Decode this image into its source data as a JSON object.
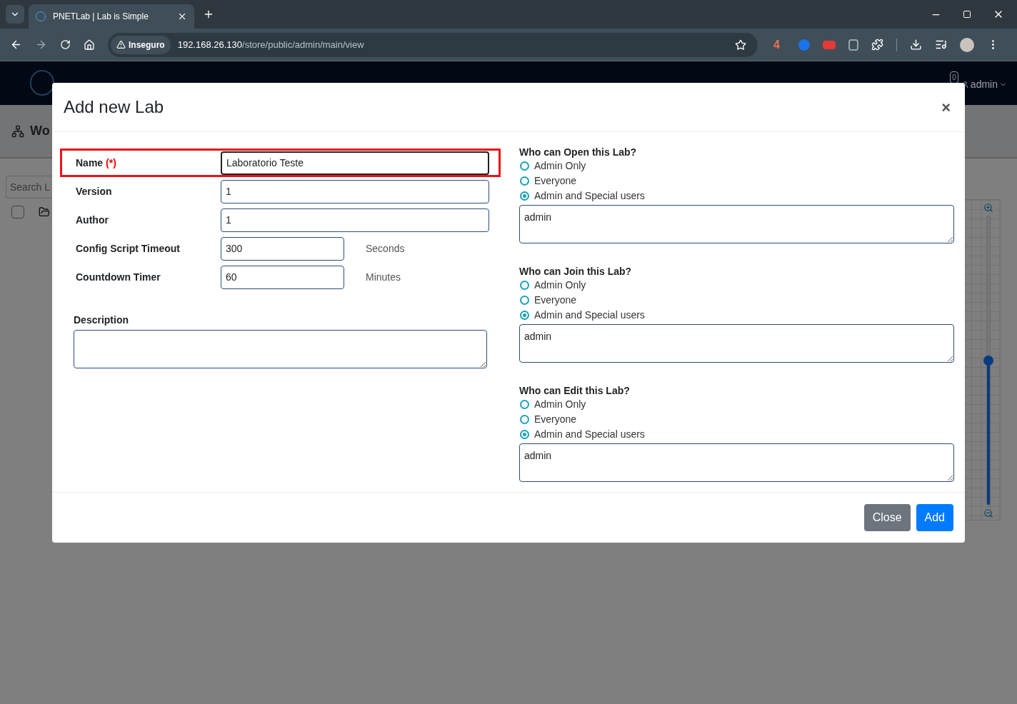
{
  "browser": {
    "tabs": [
      {
        "title": "PNETLab | Lab is Simple",
        "selected": true
      }
    ],
    "address": {
      "security": "Inseguro",
      "host": "192.168.26.130",
      "path": "/store/public/admin/main/view"
    },
    "extension_badge": "4"
  },
  "navbar": {
    "notification_count": "0",
    "user": "admin"
  },
  "page": {
    "title": "Wo",
    "search": {
      "placeholder": "Search L"
    },
    "select_all": {
      "checked": false
    },
    "zoom_slider": {
      "level": 0.5
    }
  },
  "modal": {
    "title": "Add new Lab",
    "close": "×",
    "fields": [
      {
        "kind": "text",
        "label": "Name",
        "required_mark": "(*)",
        "value": "Laboratorio Teste",
        "highlighted": true,
        "focused": true
      },
      {
        "kind": "text",
        "label": "Version",
        "value": "1"
      },
      {
        "kind": "text",
        "label": "Author",
        "value": "1"
      },
      {
        "kind": "short",
        "label": "Config Script Timeout",
        "value": "300",
        "unit": "Seconds"
      },
      {
        "kind": "short",
        "label": "Countdown Timer",
        "value": "60",
        "unit": "Minutes"
      },
      {
        "kind": "textarea",
        "label": "Description"
      }
    ],
    "permissions": [
      {
        "title": "Who can Open this Lab?",
        "options": [
          {
            "label": "Admin Only",
            "selected": false
          },
          {
            "label": "Everyone",
            "selected": false
          },
          {
            "label": "Admin and Special users",
            "selected": true
          }
        ],
        "users": "admin"
      },
      {
        "title": "Who can Join this Lab?",
        "options": [
          {
            "label": "Admin Only",
            "selected": false
          },
          {
            "label": "Everyone",
            "selected": false
          },
          {
            "label": "Admin and Special users",
            "selected": true
          }
        ],
        "users": "admin"
      },
      {
        "title": "Who can Edit this Lab?",
        "options": [
          {
            "label": "Admin Only",
            "selected": false
          },
          {
            "label": "Everyone",
            "selected": false
          },
          {
            "label": "Admin and Special users",
            "selected": true
          }
        ],
        "users": "admin"
      }
    ],
    "buttons": [
      {
        "label": "Close",
        "kind": "secondary"
      },
      {
        "label": "Add",
        "kind": "primary"
      }
    ]
  }
}
